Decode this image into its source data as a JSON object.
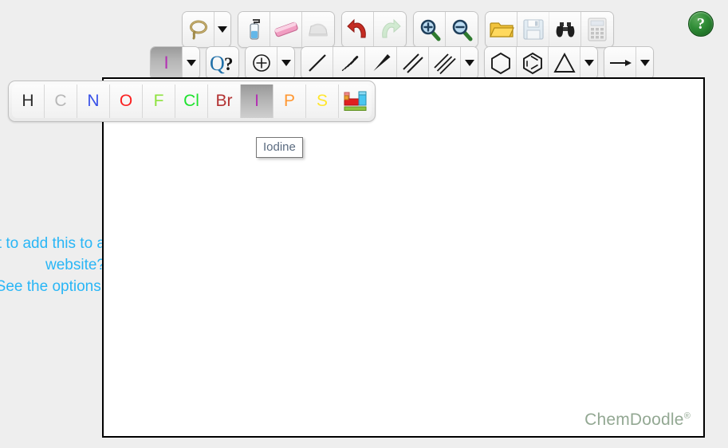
{
  "app": {
    "name": "ChemDoodle",
    "watermark": "ChemDoodle",
    "watermark_mark": "®",
    "background_color": "#eeeeee",
    "canvas_color": "#ffffff"
  },
  "help": {
    "label": "?",
    "name": "help-button",
    "color": "#2f8c36"
  },
  "tooltip": {
    "text": "Iodine",
    "color": "#5b6b80"
  },
  "promo": {
    "lines": [
      "Want to add this to a",
      "website?",
      "See the options!"
    ],
    "color": "#29b6f6"
  },
  "toolbar_row_1": {
    "groups": [
      {
        "name": "lasso-group",
        "items": [
          {
            "name": "lasso-tool",
            "label": "Lasso",
            "icon": "lasso-icon",
            "state": "enabled"
          },
          {
            "name": "lasso-dropdown",
            "label": "Lasso options",
            "icon": "chevron-down-icon",
            "state": "enabled"
          }
        ]
      },
      {
        "name": "edit-group",
        "items": [
          {
            "name": "clear-tool",
            "label": "Clear",
            "icon": "spray-bottle-icon",
            "state": "enabled"
          },
          {
            "name": "erase-tool",
            "label": "Erase",
            "icon": "eraser-icon",
            "state": "enabled"
          },
          {
            "name": "flatten-tool",
            "label": "Flatten",
            "icon": "iron-icon",
            "state": "disabled"
          }
        ]
      },
      {
        "name": "history-group",
        "items": [
          {
            "name": "undo-button",
            "label": "Undo",
            "icon": "undo-arrow-icon",
            "state": "enabled"
          },
          {
            "name": "redo-button",
            "label": "Redo",
            "icon": "redo-arrow-icon",
            "state": "disabled"
          }
        ]
      },
      {
        "name": "zoom-group",
        "items": [
          {
            "name": "zoom-in-button",
            "label": "Zoom In",
            "icon": "magnifier-plus-icon",
            "state": "enabled"
          },
          {
            "name": "zoom-out-button",
            "label": "Zoom Out",
            "icon": "magnifier-minus-icon",
            "state": "enabled"
          }
        ]
      },
      {
        "name": "file-group",
        "items": [
          {
            "name": "open-button",
            "label": "Open",
            "icon": "folder-icon",
            "state": "enabled"
          },
          {
            "name": "save-button",
            "label": "Save",
            "icon": "floppy-disk-icon",
            "state": "disabled"
          },
          {
            "name": "search-button",
            "label": "Search",
            "icon": "binoculars-icon",
            "state": "enabled"
          },
          {
            "name": "calculate-button",
            "label": "Calculate",
            "icon": "calculator-icon",
            "state": "disabled"
          }
        ]
      }
    ]
  },
  "toolbar_row_2": {
    "groups": [
      {
        "name": "atom-group",
        "items": [
          {
            "name": "element-tool",
            "label": "I",
            "icon": "element-label-icon",
            "state": "active",
            "color": "#b32fb3"
          },
          {
            "name": "element-dropdown",
            "label": "Element options",
            "icon": "chevron-down-icon",
            "state": "enabled"
          }
        ]
      },
      {
        "name": "query-group",
        "items": [
          {
            "name": "query-tool",
            "label": "Q?",
            "icon": "query-icon",
            "state": "enabled"
          }
        ]
      },
      {
        "name": "charge-group",
        "items": [
          {
            "name": "charge-tool",
            "label": "Charge",
            "icon": "plus-circle-icon",
            "state": "enabled"
          },
          {
            "name": "charge-dropdown",
            "label": "Charge options",
            "icon": "chevron-down-icon",
            "state": "enabled"
          }
        ]
      },
      {
        "name": "bond-group",
        "items": [
          {
            "name": "single-bond-tool",
            "label": "Single Bond",
            "icon": "single-bond-icon",
            "state": "enabled"
          },
          {
            "name": "hash-bond-tool",
            "label": "Recessed Bond",
            "icon": "hashed-wedge-bond-icon",
            "state": "enabled"
          },
          {
            "name": "wedge-bond-tool",
            "label": "Protruding Bond",
            "icon": "wedge-bond-icon",
            "state": "enabled"
          },
          {
            "name": "double-bond-tool",
            "label": "Double Bond",
            "icon": "double-bond-icon",
            "state": "enabled"
          },
          {
            "name": "triple-bond-tool",
            "label": "Triple Bond",
            "icon": "triple-bond-icon",
            "state": "enabled"
          },
          {
            "name": "bond-dropdown",
            "label": "Bond options",
            "icon": "chevron-down-icon",
            "state": "enabled"
          }
        ]
      },
      {
        "name": "ring-group",
        "items": [
          {
            "name": "cyclohexane-tool",
            "label": "Cyclohexane",
            "icon": "hexagon-icon",
            "state": "enabled"
          },
          {
            "name": "benzene-tool",
            "label": "Benzene",
            "icon": "benzene-ring-icon",
            "state": "enabled"
          },
          {
            "name": "cyclopropane-tool",
            "label": "Cyclopropane",
            "icon": "triangle-icon",
            "state": "enabled"
          },
          {
            "name": "ring-dropdown",
            "label": "Ring options",
            "icon": "chevron-down-icon",
            "state": "enabled"
          }
        ]
      },
      {
        "name": "arrow-group",
        "items": [
          {
            "name": "arrow-tool",
            "label": "Arrow",
            "icon": "arrow-right-icon",
            "state": "enabled"
          },
          {
            "name": "arrow-dropdown",
            "label": "Arrow options",
            "icon": "chevron-down-icon",
            "state": "enabled"
          }
        ]
      }
    ]
  },
  "element_bar": {
    "selected": "I",
    "elements": [
      {
        "symbol": "H",
        "name": "Hydrogen",
        "color": "#2b2b2b"
      },
      {
        "symbol": "C",
        "name": "Carbon",
        "color": "#b7b7b7"
      },
      {
        "symbol": "N",
        "name": "Nitrogen",
        "color": "#3a52e8"
      },
      {
        "symbol": "O",
        "name": "Oxygen",
        "color": "#fb2121"
      },
      {
        "symbol": "F",
        "name": "Fluorine",
        "color": "#8ee23f"
      },
      {
        "symbol": "Cl",
        "name": "Chlorine",
        "color": "#1fe22f"
      },
      {
        "symbol": "Br",
        "name": "Bromine",
        "color": "#b33232"
      },
      {
        "symbol": "I",
        "name": "Iodine",
        "color": "#b32fb3"
      },
      {
        "symbol": "P",
        "name": "Phosphorus",
        "color": "#ff9833"
      },
      {
        "symbol": "S",
        "name": "Sulfur",
        "color": "#ffe62e"
      }
    ],
    "periodic_table_button": {
      "name": "periodic-table-button",
      "label": "Periodic Table",
      "icon": "periodic-table-icon"
    }
  }
}
